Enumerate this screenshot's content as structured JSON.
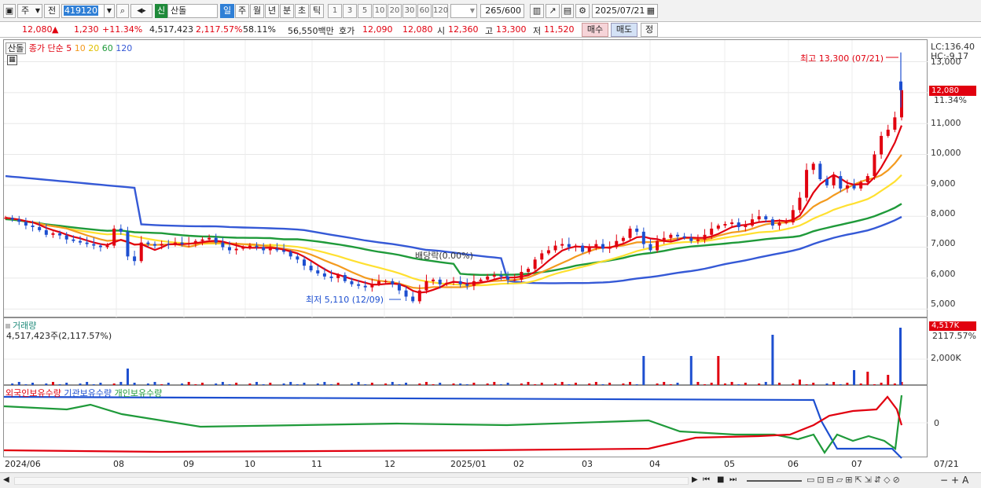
{
  "toolbar": {
    "unit": "주",
    "prev": "전",
    "code": "419120",
    "name_badge": "신",
    "name": "산돌",
    "periods": [
      "일",
      "주",
      "월",
      "년",
      "분",
      "초",
      "틱"
    ],
    "periods_active": "일",
    "intervals": [
      "1",
      "3",
      "5",
      "10",
      "20",
      "30",
      "60",
      "120"
    ],
    "count": "265",
    "count_max": "/600",
    "date": "2025/07/21"
  },
  "info": {
    "price": "12,080",
    "arrow": "▲",
    "change": "1,230",
    "pct": "+11.34%",
    "volume": "4,517,423",
    "vol_ratio": "2,117.57%",
    "turnover": "58.11%",
    "amount": "56,550백만",
    "ask_label": "호가",
    "ask": "12,090",
    "bid": "12,080",
    "open_label": "시",
    "open": "12,360",
    "high_label": "고",
    "high": "13,300",
    "low_label": "저",
    "low": "11,520",
    "buy_btn": "매수",
    "sell_btn": "매도",
    "menu_btn": "정"
  },
  "legend": {
    "name": "산돌",
    "series": "종가 단순",
    "ma5": "5",
    "ma10": "10",
    "ma20": "20",
    "ma60": "60",
    "ma120": "120"
  },
  "price_axis": {
    "ticks": [
      "13,000",
      "12,000",
      "11,000",
      "10,000",
      "9,000",
      "8,000",
      "7,000",
      "6,000",
      "5,000"
    ],
    "lc": "LC:136.40",
    "hc": "HC:-9.17",
    "cur": "12,080",
    "cur_pct": "11.34%"
  },
  "annotations": {
    "high": "최고 13,300 (07/21)",
    "low": "최저 5,110 (12/09)",
    "dividend": "배당락(0.00%)"
  },
  "volume": {
    "title": "거래량",
    "value": "4,517,423주(2,117.57%)",
    "tick": "2,000K",
    "cur": "4,517K",
    "cur_pct": "2117.57%"
  },
  "holdings": {
    "foreign": "외국인보유수량",
    "inst": "기관보유수량",
    "retail": "개인보유수량",
    "tick": "0"
  },
  "xaxis": [
    "2024/06",
    "08",
    "09",
    "10",
    "11",
    "12",
    "2025/01",
    "02",
    "03",
    "04",
    "05",
    "06",
    "07",
    "07/21"
  ],
  "colors": {
    "up": "#e1000f",
    "down": "#1d4fd0",
    "ma5": "#e1000f",
    "ma10": "#f39a1e",
    "ma20": "#ffe030",
    "ma60": "#1f9a3a",
    "ma120": "#3559d6"
  },
  "chart_data": {
    "type": "candlestick",
    "ylim": [
      4700,
      13700
    ],
    "closes": [
      7950,
      7900,
      7820,
      7700,
      7650,
      7550,
      7400,
      7450,
      7380,
      7250,
      7200,
      7150,
      7100,
      7050,
      7000,
      7050,
      7600,
      7500,
      6700,
      6550,
      7150,
      7100,
      7050,
      7100,
      7080,
      7150,
      7100,
      7120,
      7200,
      7250,
      7300,
      7150,
      7000,
      6900,
      6950,
      7000,
      7050,
      7000,
      6900,
      6950,
      6900,
      6850,
      6700,
      6600,
      6400,
      6250,
      6150,
      6050,
      6000,
      6100,
      5900,
      5800,
      5750,
      5700,
      5800,
      5900,
      5900,
      5800,
      5600,
      5400,
      5250,
      5600,
      5900,
      5950,
      5800,
      5850,
      5900,
      5800,
      5750,
      5900,
      5950,
      6050,
      6100,
      6050,
      5950,
      5950,
      6200,
      6300,
      6600,
      6800,
      6900,
      7050,
      7100,
      7000,
      7050,
      6850,
      7000,
      7100,
      6950,
      7000,
      7200,
      7300,
      7600,
      7500,
      7100,
      6900,
      7200,
      7300,
      7400,
      7350,
      7300,
      7200,
      7250,
      7400,
      7600,
      7700,
      7750,
      7800,
      7650,
      7700,
      7900,
      8000,
      7900,
      7700,
      7800,
      7800,
      8200,
      8600,
      9500,
      9700,
      9200,
      9000,
      9300,
      8900,
      9000,
      8900,
      9100,
      9300,
      10000,
      10600,
      10800,
      11200,
      12080
    ],
    "ma5_last": 10600,
    "ma10_last": 9900,
    "ma20_last": 9600,
    "ma60_last": 8400,
    "ma120_last": 7600,
    "high": 13300,
    "low": 5110,
    "volume_last": 4517423
  }
}
